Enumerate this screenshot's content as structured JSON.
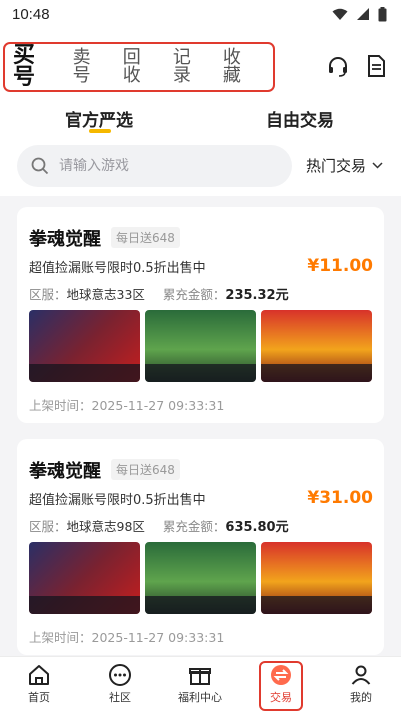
{
  "status_bar": {
    "time": "10:48"
  },
  "header": {
    "tabs": [
      {
        "label": "买号",
        "active": true
      },
      {
        "label": "卖号",
        "active": false
      },
      {
        "label": "回收",
        "active": false
      },
      {
        "label": "记录",
        "active": false
      },
      {
        "label": "收藏",
        "active": false
      }
    ],
    "icons": [
      "headset-icon",
      "document-icon"
    ]
  },
  "subtabs": [
    {
      "label": "官方严选",
      "active": true
    },
    {
      "label": "自由交易",
      "active": false
    }
  ],
  "search": {
    "placeholder": "请输入游戏",
    "sort_label": "热门交易"
  },
  "listings": [
    {
      "title": "拳魂觉醒",
      "badge": "每日送648",
      "desc": "超值捡漏账号限时0.5折出售中",
      "price": "¥11.00",
      "server_label": "区服：",
      "server": "地球意志33区",
      "recharge_label": "累充金额：",
      "recharge": "235.32元",
      "listed_label": "上架时间：",
      "listed": "2025-11-27 09:33:31"
    },
    {
      "title": "拳魂觉醒",
      "badge": "每日送648",
      "desc": "超值捡漏账号限时0.5折出售中",
      "price": "¥31.00",
      "server_label": "区服：",
      "server": "地球意志98区",
      "recharge_label": "累充金额：",
      "recharge": "635.80元",
      "listed_label": "上架时间：",
      "listed": "2025-11-27 09:33:31"
    }
  ],
  "bottom_nav": [
    {
      "label": "首页",
      "icon": "home-icon"
    },
    {
      "label": "社区",
      "icon": "community-icon"
    },
    {
      "label": "福利中心",
      "icon": "gift-icon"
    },
    {
      "label": "交易",
      "icon": "trade-icon",
      "active": true
    },
    {
      "label": "我的",
      "icon": "profile-icon"
    }
  ],
  "colors": {
    "accent": "#ff7a00",
    "highlight": "#e03a2e",
    "underline": "#f5b800"
  }
}
